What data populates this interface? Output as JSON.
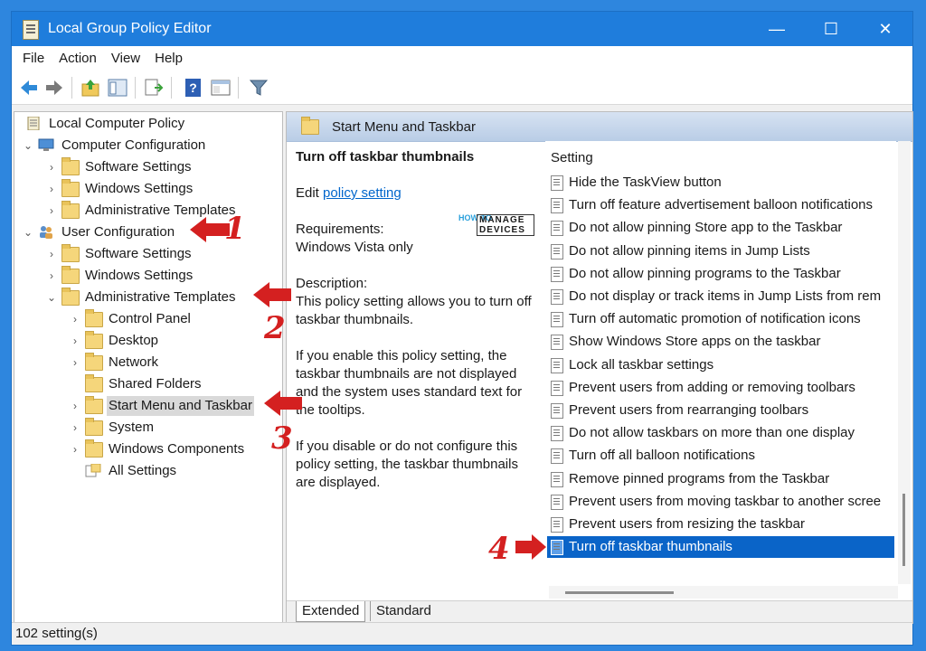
{
  "window": {
    "title": "Local Group Policy Editor",
    "minimize": "—",
    "maximize": "☐",
    "close": "✕"
  },
  "menu": [
    "File",
    "Action",
    "View",
    "Help"
  ],
  "tree": {
    "root": "Local Computer Policy",
    "computer_config": "Computer Configuration",
    "cc_software": "Software Settings",
    "cc_windows": "Windows Settings",
    "cc_admin": "Administrative Templates",
    "user_config": "User Configuration",
    "uc_software": "Software Settings",
    "uc_windows": "Windows Settings",
    "uc_admin": "Administrative Templates",
    "control_panel": "Control Panel",
    "desktop": "Desktop",
    "network": "Network",
    "shared_folders": "Shared Folders",
    "start_menu": "Start Menu and Taskbar",
    "system": "System",
    "windows_components": "Windows Components",
    "all_settings": "All Settings"
  },
  "right": {
    "header": "Start Menu and Taskbar",
    "desc_title": "Turn off taskbar thumbnails",
    "edit_prefix": "Edit",
    "edit_link": "policy setting",
    "req_label": "Requirements:",
    "req_value": "Windows Vista only",
    "desc_label": "Description:",
    "desc_p1": "This policy setting allows you to turn off taskbar thumbnails.",
    "desc_p2": "If you enable this policy setting, the taskbar thumbnails are not displayed and the system uses standard text for the tooltips.",
    "desc_p3": "If you disable or do not configure this policy setting, the taskbar thumbnails are displayed.",
    "settings_header": "Setting",
    "settings": [
      "Hide the TaskView button",
      "Turn off feature advertisement balloon notifications",
      "Do not allow pinning Store app to the Taskbar",
      "Do not allow pinning items in Jump Lists",
      "Do not allow pinning programs to the Taskbar",
      "Do not display or track items in Jump Lists from rem",
      "Turn off automatic promotion of notification icons",
      "Show Windows Store apps on the taskbar",
      "Lock all taskbar settings",
      "Prevent users from adding or removing toolbars",
      "Prevent users from rearranging toolbars",
      "Do not allow taskbars on more than one display",
      "Turn off all balloon notifications",
      "Remove pinned programs from the Taskbar",
      "Prevent users from moving taskbar to another scree",
      "Prevent users from resizing the taskbar",
      "Turn off taskbar thumbnails"
    ],
    "selected_setting_index": 16,
    "tabs": [
      "Extended",
      "Standard"
    ]
  },
  "status": "102 setting(s)",
  "annotations": {
    "step1": "1",
    "step2": "2",
    "step3": "3",
    "step4": "4",
    "arrow_color": "#d42020"
  },
  "watermark": {
    "how_to": "HOW TO",
    "manage_devices": "MANAGE DEVICES"
  },
  "colors": {
    "titlebar": "#1f7ddc",
    "selection": "#0a64c8",
    "frame": "#2e86de"
  }
}
